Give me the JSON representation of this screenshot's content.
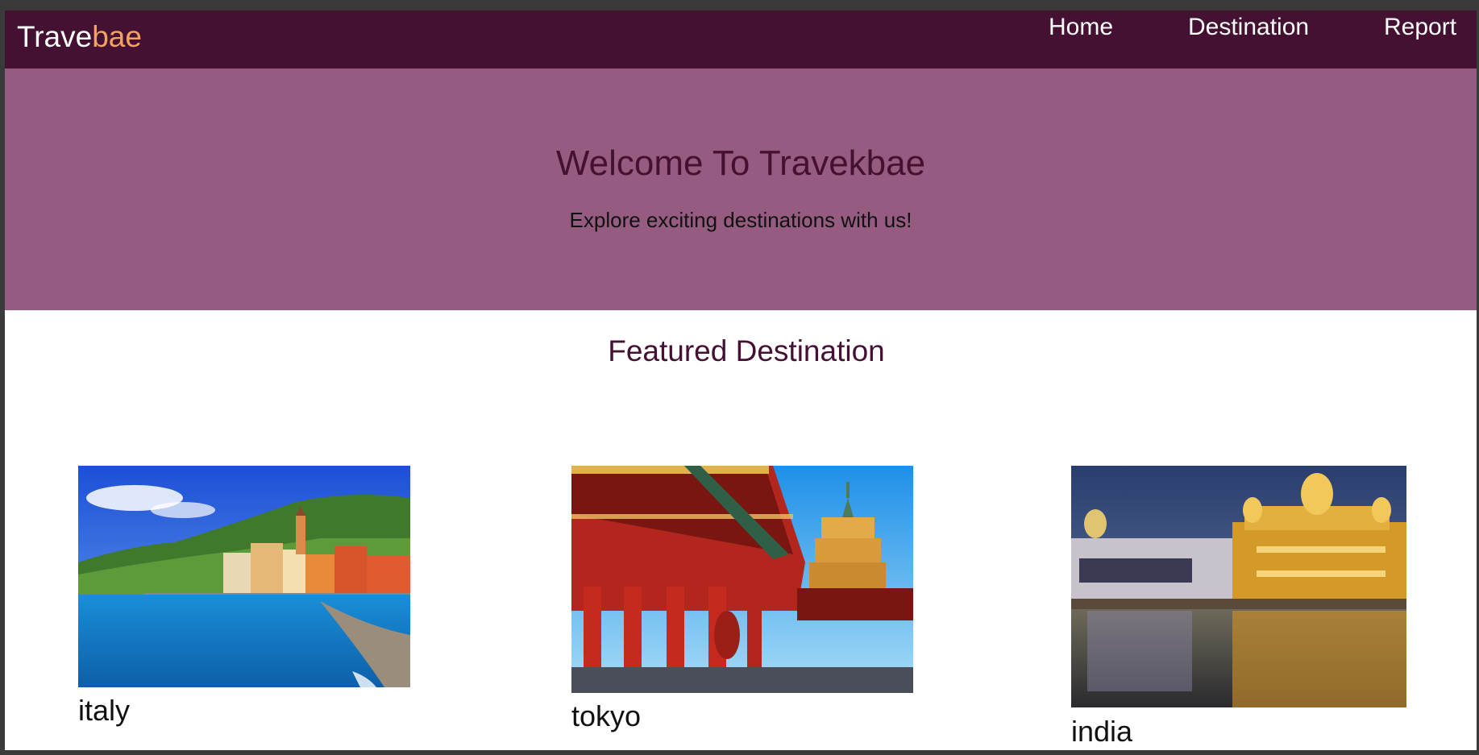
{
  "nav": {
    "brand_main": "Trave",
    "brand_accent": "bae",
    "links": [
      "Home",
      "Destination",
      "Report"
    ]
  },
  "hero": {
    "title": "Welcome To Travekbae",
    "subtitle": "Explore exciting destinations with us!"
  },
  "featured": {
    "title": "Featured Destination",
    "destinations": [
      {
        "name": "italy"
      },
      {
        "name": "tokyo"
      },
      {
        "name": "india"
      }
    ]
  },
  "colors": {
    "navbar": "#441133",
    "hero": "#955b80",
    "brand_accent": "#f4a261"
  }
}
